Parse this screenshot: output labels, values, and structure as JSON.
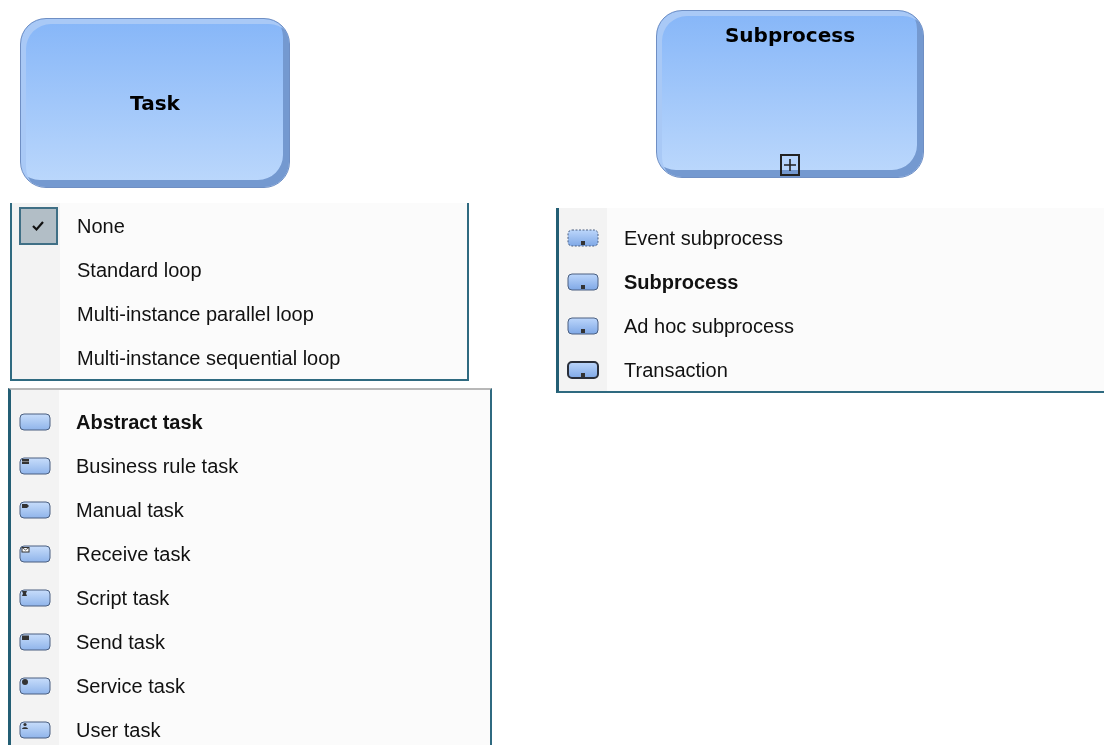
{
  "shapes": [
    {
      "kind": "task",
      "label": "Task"
    },
    {
      "kind": "subprocess",
      "label": "Subprocess"
    }
  ],
  "loop_menu": {
    "items": [
      {
        "label": "None",
        "checked": true
      },
      {
        "label": "Standard loop",
        "checked": false
      },
      {
        "label": "Multi-instance parallel loop",
        "checked": false
      },
      {
        "label": "Multi-instance sequential loop",
        "checked": false
      }
    ]
  },
  "task_type_menu": {
    "items": [
      {
        "label": "Abstract task",
        "kind": "abstract",
        "current": true
      },
      {
        "label": "Business rule task",
        "kind": "business_rule",
        "current": false
      },
      {
        "label": "Manual task",
        "kind": "manual",
        "current": false
      },
      {
        "label": "Receive task",
        "kind": "receive",
        "current": false
      },
      {
        "label": "Script task",
        "kind": "script",
        "current": false
      },
      {
        "label": "Send task",
        "kind": "send",
        "current": false
      },
      {
        "label": "Service task",
        "kind": "service",
        "current": false
      },
      {
        "label": "User task",
        "kind": "user",
        "current": false
      }
    ]
  },
  "subprocess_type_menu": {
    "items": [
      {
        "label": "Event subprocess",
        "kind": "event",
        "current": false
      },
      {
        "label": "Subprocess",
        "kind": "subprocess",
        "current": true
      },
      {
        "label": "Ad hoc subprocess",
        "kind": "adhoc",
        "current": false
      },
      {
        "label": "Transaction",
        "kind": "transaction",
        "current": false
      }
    ]
  }
}
